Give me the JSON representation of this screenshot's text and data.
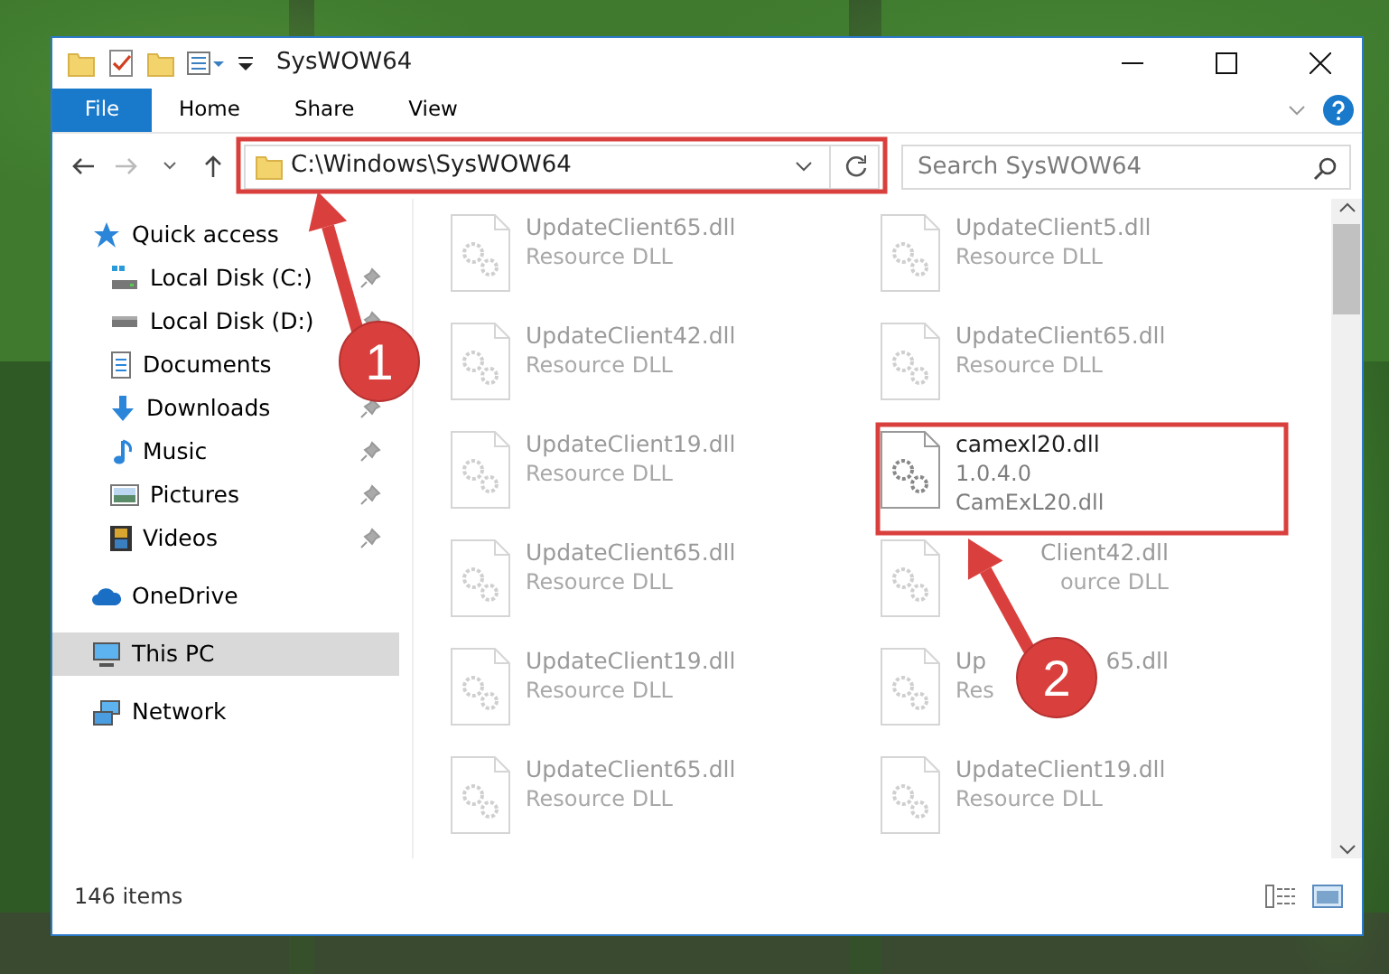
{
  "window": {
    "title": "SysWOW64"
  },
  "ribbon_tabs": [
    {
      "label": "File",
      "kind": "file"
    },
    {
      "label": "Home",
      "kind": "tab"
    },
    {
      "label": "Share",
      "kind": "tab"
    },
    {
      "label": "View",
      "kind": "tab"
    }
  ],
  "address": {
    "path": "C:\\Windows\\SysWOW64"
  },
  "search": {
    "placeholder": "Search SysWOW64"
  },
  "sidebar": {
    "items": [
      {
        "label": "Quick access",
        "kind": "star",
        "selected": false,
        "children": [
          {
            "label": "Local Disk (C:)",
            "kind": "systemdrive",
            "pinned": true,
            "selected": false
          },
          {
            "label": "Local Disk (D:)",
            "kind": "drive",
            "pinned": true,
            "selected": false
          },
          {
            "label": "Documents",
            "kind": "documents",
            "selected": false
          },
          {
            "label": "Downloads",
            "kind": "downloads",
            "pinned": true,
            "selected": false
          },
          {
            "label": "Music",
            "kind": "music",
            "pinned": true,
            "selected": false
          },
          {
            "label": "Pictures",
            "kind": "pictures",
            "pinned": true,
            "selected": false
          },
          {
            "label": "Videos",
            "kind": "videos",
            "pinned": true,
            "selected": false
          }
        ]
      },
      {
        "label": "OneDrive",
        "kind": "cloud",
        "selected": false
      },
      {
        "label": "This PC",
        "kind": "computer",
        "selected": true
      },
      {
        "label": "Network",
        "kind": "network",
        "selected": false
      }
    ]
  },
  "files": [
    {
      "lines": [
        "UpdateClient65.dll",
        "Resource DLL"
      ],
      "faded": true
    },
    {
      "lines": [
        "UpdateClient5.dll",
        "Resource DLL"
      ],
      "faded": true
    },
    {
      "lines": [
        "UpdateClient42.dll",
        "Resource DLL"
      ],
      "faded": true
    },
    {
      "lines": [
        "UpdateClient65.dll",
        "Resource DLL"
      ],
      "faded": true
    },
    {
      "lines": [
        "UpdateClient19.dll",
        "Resource DLL"
      ],
      "faded": true
    },
    {
      "lines": [
        "camexl20.dll",
        "1.0.4.0",
        "CamExL20.dll"
      ],
      "faded": false
    },
    {
      "lines": [
        "UpdateClient65.dll",
        "Resource DLL"
      ],
      "faded": true
    },
    {
      "lines": [
        {
          "end": "Client42.dll"
        },
        {
          "end": "ource DLL"
        }
      ],
      "faded": true
    },
    {
      "lines": [
        "UpdateClient19.dll",
        "Resource DLL"
      ],
      "faded": true
    },
    {
      "lines": [
        {
          "start": "Up",
          "end": "65.dll"
        },
        {
          "start": "Res"
        }
      ],
      "faded": true
    },
    {
      "lines": [
        "UpdateClient65.dll",
        "Resource DLL"
      ],
      "faded": true
    },
    {
      "lines": [
        "UpdateClient19.dll",
        "Resource DLL"
      ],
      "faded": true
    }
  ],
  "status_bar": {
    "count": "146 items"
  },
  "annotations": [
    {
      "number": "1"
    },
    {
      "number": "2"
    }
  ]
}
